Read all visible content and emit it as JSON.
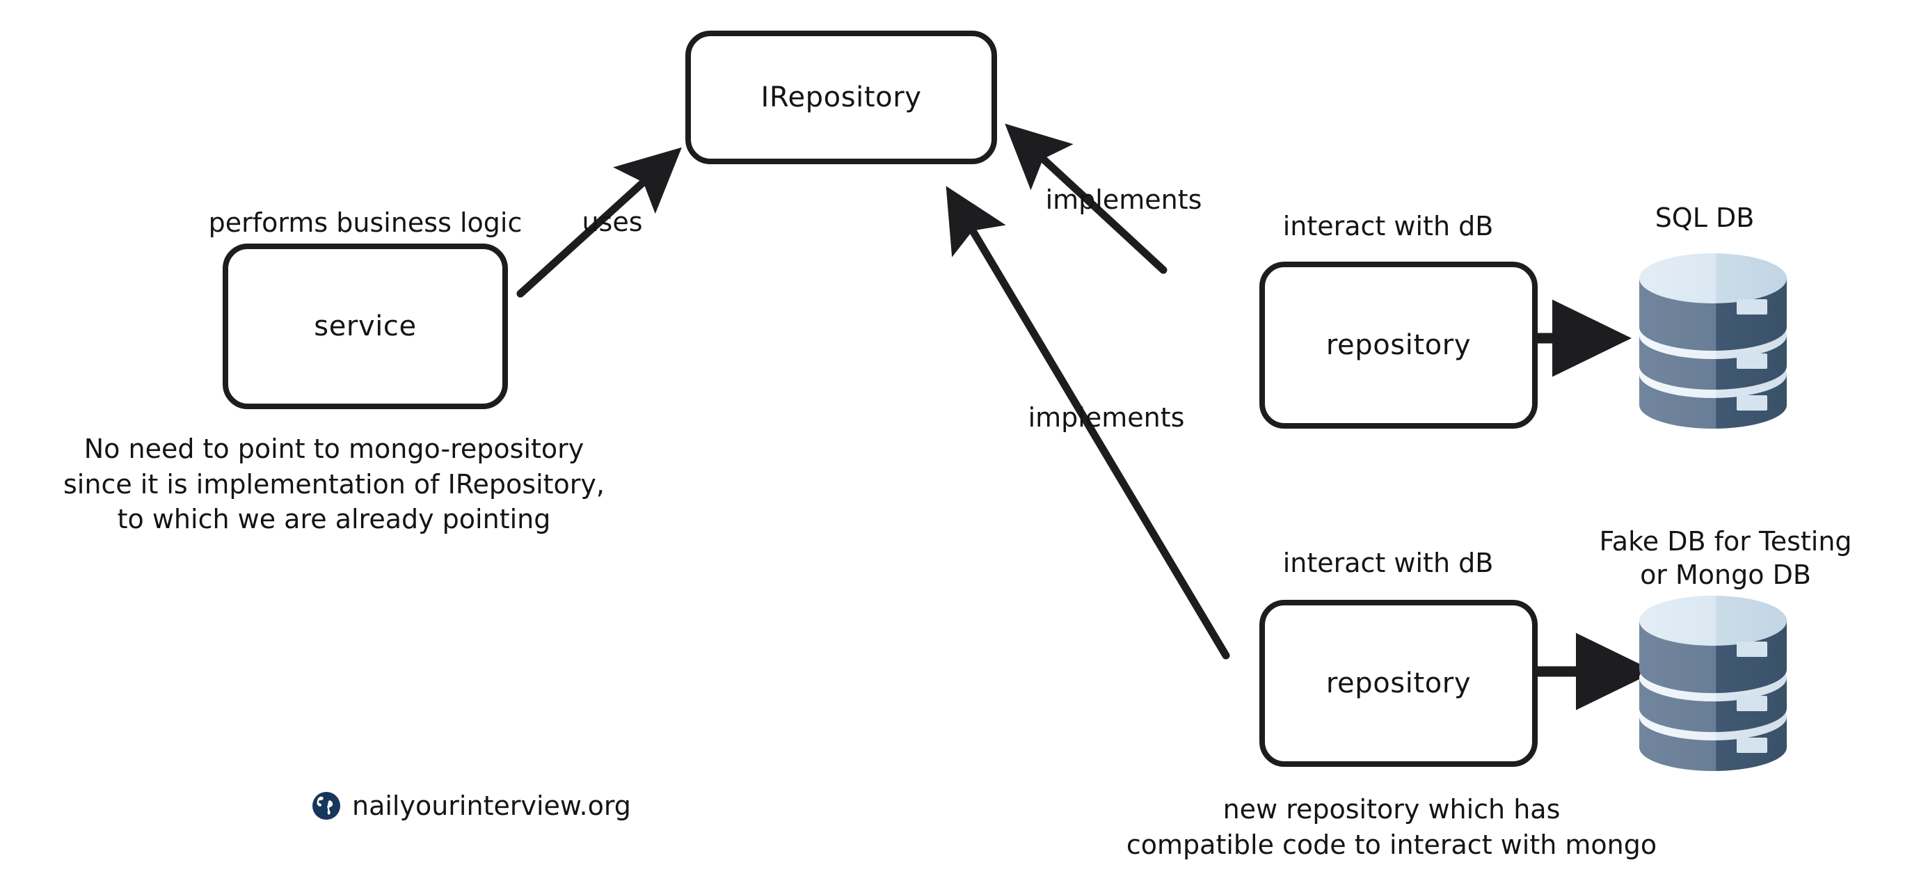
{
  "diagram": {
    "title": "Repository pattern with IRepository abstraction",
    "background_color": "#ffffff",
    "stroke_color": "#1d1d1f",
    "text_color": "#141414"
  },
  "nodes": {
    "irepository": {
      "label": "IRepository"
    },
    "service": {
      "label": "service"
    },
    "sql_repository": {
      "label": "repository"
    },
    "mongo_repository": {
      "label": "repository"
    }
  },
  "edges": {
    "service_uses": {
      "label": "uses"
    },
    "sql_implements": {
      "label": "implements"
    },
    "mongo_implements": {
      "label": "implements"
    },
    "sql_interact": {
      "label": "interact with dB"
    },
    "mongo_interact": {
      "label": "interact with dB"
    }
  },
  "databases": {
    "sql": {
      "title": "SQL DB",
      "colors": {
        "top_light": "#dfeaf3",
        "top_dark": "#c9dbe9",
        "body_light": "#6b7f99",
        "body_dark": "#3e5670",
        "band": "#eef4f8",
        "slot": "#d5e3ef"
      }
    },
    "mongo": {
      "title_line1": "Fake DB for Testing",
      "title_line2": "or Mongo DB",
      "colors": {
        "top_light": "#dfeaf3",
        "top_dark": "#c9dbe9",
        "body_light": "#6b7f99",
        "body_dark": "#3e5670",
        "band": "#eef4f8",
        "slot": "#d5e3ef"
      }
    }
  },
  "annotations": {
    "service_note": "No need to point to mongo-repository\nsince it is implementation of IRepository,\nto which we are already pointing",
    "mongo_note": "new repository which has\ncompatible code to interact with mongo",
    "service_role": "performs business logic"
  },
  "footer": {
    "site": "nailyourinterview.org",
    "icon": "globe-icon",
    "icon_color": "#17365c"
  }
}
